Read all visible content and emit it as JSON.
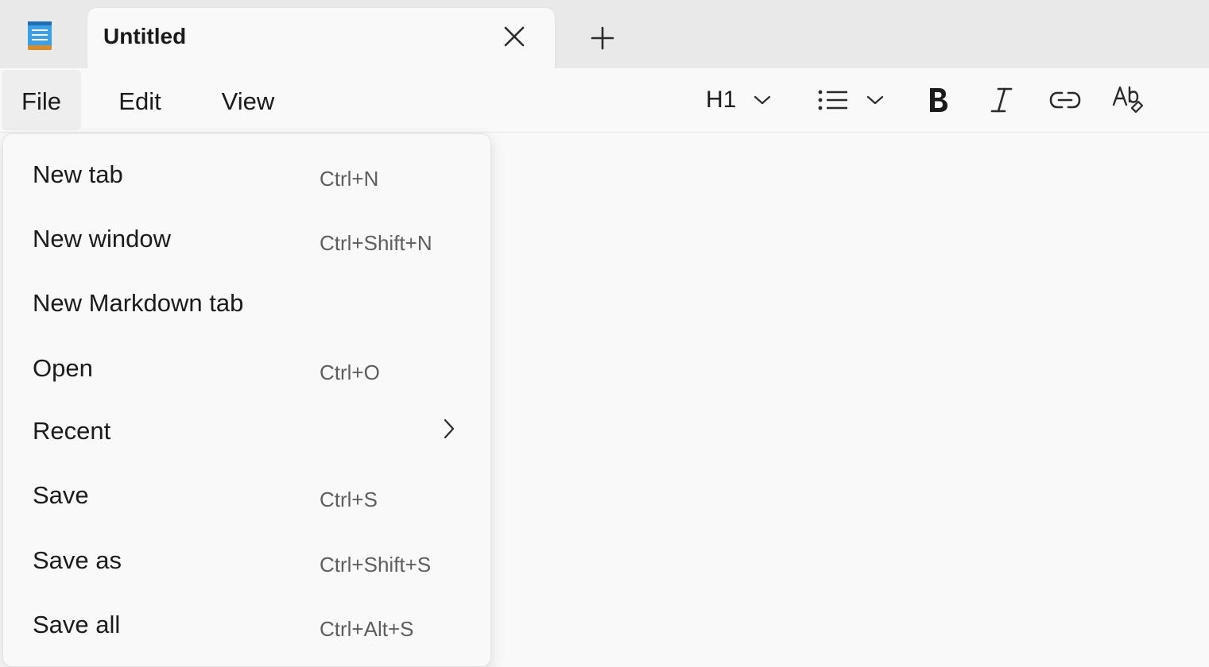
{
  "tab": {
    "title": "Untitled"
  },
  "menubar": {
    "file": "File",
    "edit": "Edit",
    "view": "View"
  },
  "toolbar": {
    "heading": "H1"
  },
  "file_menu": {
    "items": [
      {
        "label": "New tab",
        "shortcut": "Ctrl+N"
      },
      {
        "label": "New window",
        "shortcut": "Ctrl+Shift+N"
      },
      {
        "label": "New Markdown tab",
        "shortcut": ""
      },
      {
        "label": "Open",
        "shortcut": "Ctrl+O"
      },
      {
        "label": "Recent",
        "shortcut": "",
        "submenu": true
      },
      {
        "label": "Save",
        "shortcut": "Ctrl+S"
      },
      {
        "label": "Save as",
        "shortcut": "Ctrl+Shift+S"
      },
      {
        "label": "Save all",
        "shortcut": "Ctrl+Alt+S"
      }
    ]
  },
  "icons": {
    "app": "notepad-icon",
    "close": "close-icon",
    "new_tab": "plus-icon",
    "heading_dropdown": "chevron-down-icon",
    "list": "bulleted-list-icon",
    "bold": "bold-icon",
    "italic": "italic-icon",
    "link": "link-icon",
    "spellcheck": "spellcheck-icon",
    "submenu": "chevron-right-icon"
  },
  "colors": {
    "accent": "#2f8fd8",
    "background": "#f9f9f9",
    "tab_strip": "#e9e9e9"
  }
}
